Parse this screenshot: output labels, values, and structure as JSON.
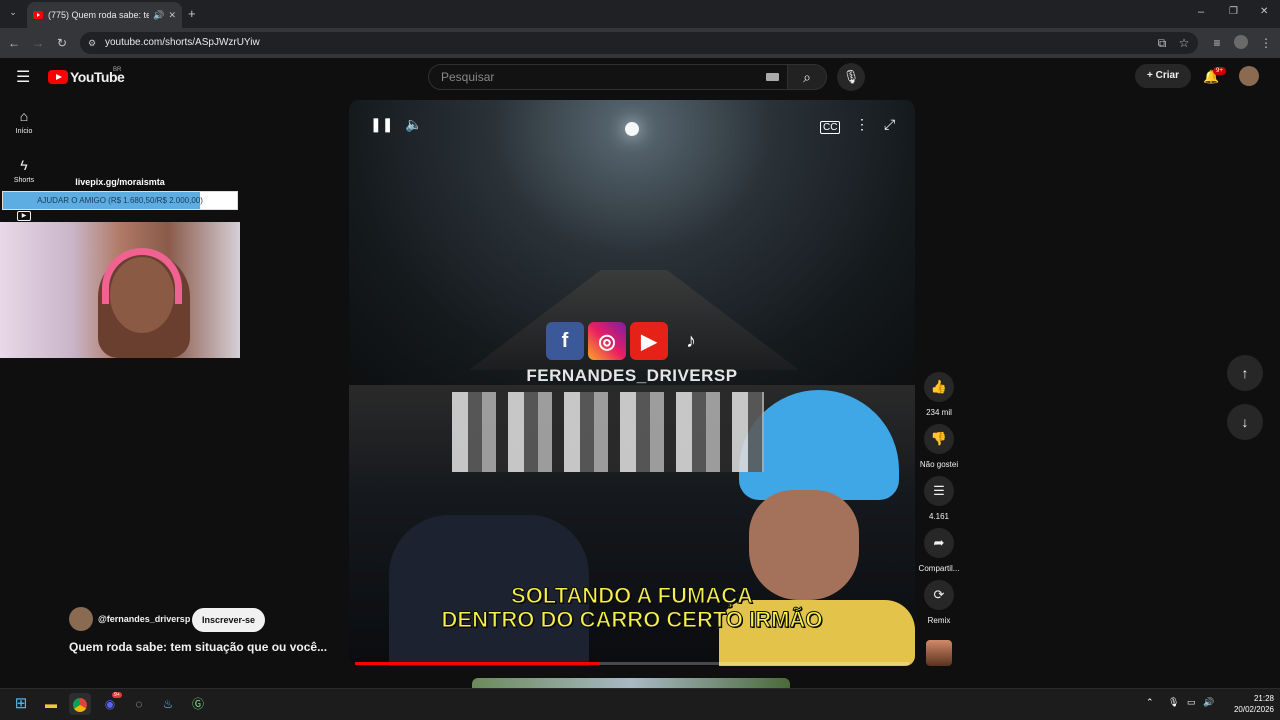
{
  "browser": {
    "tab_title": "(775) Quem roda sabe: tem",
    "url": "youtube.com/shorts/ASpJWzrUYiw"
  },
  "youtube": {
    "logo_text": "YouTube",
    "region": "BR",
    "search_placeholder": "Pesquisar",
    "create_label": "Criar",
    "notif_count": "9+"
  },
  "sidebar": {
    "items": [
      {
        "label": "Início"
      },
      {
        "label": "Shorts"
      }
    ]
  },
  "overlay": {
    "title": "livepix.gg/moraismta",
    "bar_text": "AJUDAR O AMIGO (R$ 1.680,50/R$ 2.000,00)",
    "progress_fraction": 0.84
  },
  "video": {
    "watermark": "FERNANDES_DRIVERSP",
    "subtitle_line1": "SOLTANDO A FUMAÇA",
    "subtitle_line2": "DENTRO DO CARRO CERTO IRMÃO",
    "progress_fraction": 0.44
  },
  "actions": {
    "like_count": "234 mil",
    "dislike_label": "Não gostei",
    "comments_count": "4.161",
    "share_label": "Compartil...",
    "remix_label": "Remix"
  },
  "channel": {
    "handle": "@fernandes_driversp",
    "subscribe_label": "Inscrever-se",
    "video_title": "Quem roda sabe: tem situação que ou você..."
  },
  "taskbar": {
    "time": "21:28",
    "date": "20/02/2026",
    "discord_badge": "9+"
  }
}
